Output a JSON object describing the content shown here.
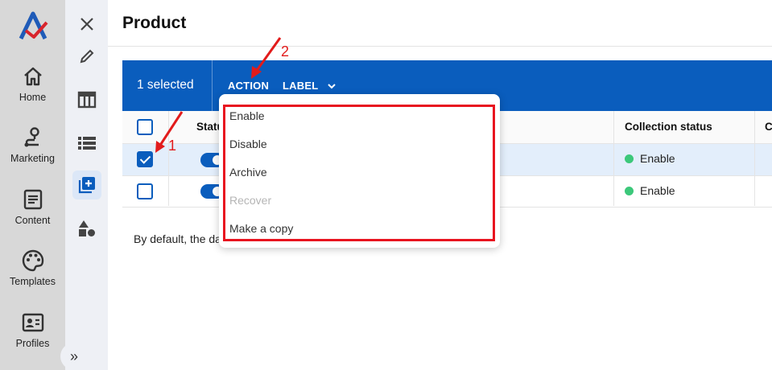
{
  "rail": {
    "items": [
      {
        "label": "Home",
        "icon": "home-icon"
      },
      {
        "label": "Marketing",
        "icon": "marketing-icon"
      },
      {
        "label": "Content",
        "icon": "content-icon"
      },
      {
        "label": "Templates",
        "icon": "palette-icon"
      },
      {
        "label": "Profiles",
        "icon": "profile-card-icon"
      }
    ]
  },
  "subrail": {
    "icons": [
      "close-icon",
      "pencil-icon",
      "table-icon",
      "list-icon",
      "add-collection-icon",
      "shapes-icon"
    ],
    "expand": "»"
  },
  "page": {
    "title": "Product"
  },
  "bulkbar": {
    "selected_text": "1 selected",
    "action_label": "ACTION",
    "label_label": "LABEL"
  },
  "table": {
    "headers": {
      "status": "Statu",
      "collection_status": "Collection status",
      "extra": "C"
    },
    "rows": [
      {
        "checked": true,
        "collection_status": "Enable"
      },
      {
        "checked": false,
        "collection_status": "Enable"
      }
    ],
    "hint": "By default, the da"
  },
  "menu": {
    "items": [
      {
        "label": "Enable",
        "disabled": false
      },
      {
        "label": "Disable",
        "disabled": false
      },
      {
        "label": "Archive",
        "disabled": false
      },
      {
        "label": "Recover",
        "disabled": true
      },
      {
        "label": "Make a copy",
        "disabled": false
      }
    ]
  },
  "annotations": {
    "step1": "1",
    "step2": "2"
  },
  "colors": {
    "brand": "#0a5dbd",
    "highlight": "#e8131f",
    "enable_dot": "#3cc87a"
  }
}
